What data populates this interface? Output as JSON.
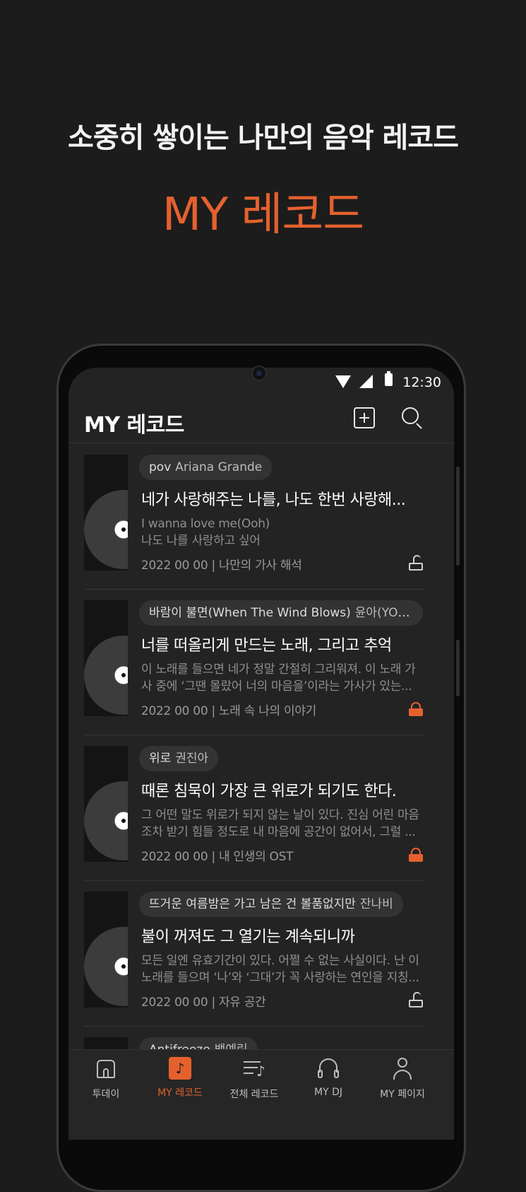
{
  "promo": {
    "headline": "소중히 쌓이는 나만의 음악 레코드",
    "subheadline": "MY 레코드"
  },
  "status_bar": {
    "time": "12:30"
  },
  "header": {
    "title": "MY 레코드"
  },
  "records": [
    {
      "song": "pov",
      "artist": "Ariana Grande",
      "title": "네가 사랑해주는 나를, 나도 한번 사랑해...",
      "excerpt": [
        "I wanna love me(Ooh)",
        "나도 나를 사랑하고 싶어"
      ],
      "meta": "2022 00 00 | 나만의 가사 해석",
      "lock": "open"
    },
    {
      "song": "바람이 불면(When The Wind Blows)",
      "artist": "윤아(YOO...",
      "title": "너를 떠올리게 만드는 노래, 그리고 추억",
      "excerpt": [
        "이 노래를 들으면 네가 정말 간절히 그리워져. 이 노래 가",
        "사 중에 ‘그땐 몰랐어 너의 마음을’이라는 가사가 있는..."
      ],
      "meta": "2022 00 00 | 노래 속 나의 이야기",
      "lock": "locked"
    },
    {
      "song": "위로",
      "artist": "권진아",
      "title": "때론 침묵이 가장 큰 위로가 되기도 한다.",
      "excerpt": [
        "그 어떤 말도 위로가 되지 않는 날이 있다. 진심 어린 마음",
        "조차 받기 힘들 정도로 내 마음에 공간이 없어서, 그럴 ..."
      ],
      "meta": "2022 00 00 | 내 인생의 OST",
      "lock": "locked"
    },
    {
      "song": "뜨거운 여름밤은 가고 남은 건 볼품없지만",
      "artist": "잔나비",
      "title": "불이 꺼져도 그 열기는 계속되니까",
      "excerpt": [
        "모든 일엔 유효기간이 있다. 어쩔 수 없는 사실이다. 난 이",
        "노래를 들으며 ‘나’와 ‘그대’가 꼭 사랑하는 연인을 지칭..."
      ],
      "meta": "2022 00 00 | 자유 공간",
      "lock": "open"
    },
    {
      "song": "Antifreeze",
      "artist": "백예린",
      "title": "",
      "excerpt": [
        "",
        ""
      ],
      "meta": "",
      "lock": "open"
    }
  ],
  "nav": [
    {
      "label": "투데이",
      "icon": "home-icon"
    },
    {
      "label": "MY 레코드",
      "icon": "music-note-icon",
      "active": true
    },
    {
      "label": "전체 레코드",
      "icon": "playlist-icon"
    },
    {
      "label": "MY DJ",
      "icon": "headphones-icon"
    },
    {
      "label": "MY 페이지",
      "icon": "person-icon"
    }
  ],
  "colors": {
    "accent": "#e4612e",
    "background": "#1c1c1c",
    "screen": "#232323"
  }
}
